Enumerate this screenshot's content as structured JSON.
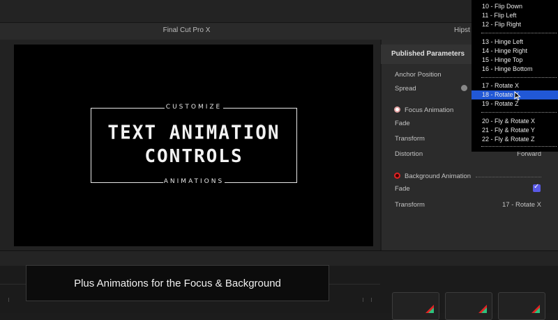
{
  "app": {
    "title": "Final Cut Pro X",
    "library_title": "Hipst"
  },
  "viewer": {
    "top_label": "CUSTOMIZE",
    "line1": "TEXT ANIMATION",
    "line2": "CONTROLS",
    "bottom_label": "ANIMATIONS"
  },
  "inspector": {
    "title": "Published Parameters",
    "anchor_position": "Anchor Position",
    "spread": "Spread",
    "focus_section": "Focus Animation",
    "fade": "Fade",
    "transform": "Transform",
    "distortion": "Distortion",
    "distortion_value": "Forward",
    "background_section": "Background Animation",
    "bg_fade": "Fade",
    "bg_transform": "Transform",
    "bg_transform_value": "17 - Rotate X"
  },
  "menu": {
    "items": [
      "10 - Flip Down",
      "11 - Flip Left",
      "12 - Flip Right",
      "13 - Hinge Left",
      "14 - Hinge Right",
      "15 - Hinge Top",
      "16 - Hinge Bottom",
      "17 - Rotate X",
      "18 - Rotate Y",
      "19 - Rotate Z",
      "20 - Fly & Rotate X",
      "21 - Fly & Rotate Y",
      "22 - Fly & Rotate Z"
    ],
    "selected": "18 - Rotate Y"
  },
  "caption": "Plus Animations for the Focus & Background",
  "colors": {
    "selection": "#2158d6",
    "checkbox": "#5a5ae6",
    "toggle_red": "#e02424"
  }
}
